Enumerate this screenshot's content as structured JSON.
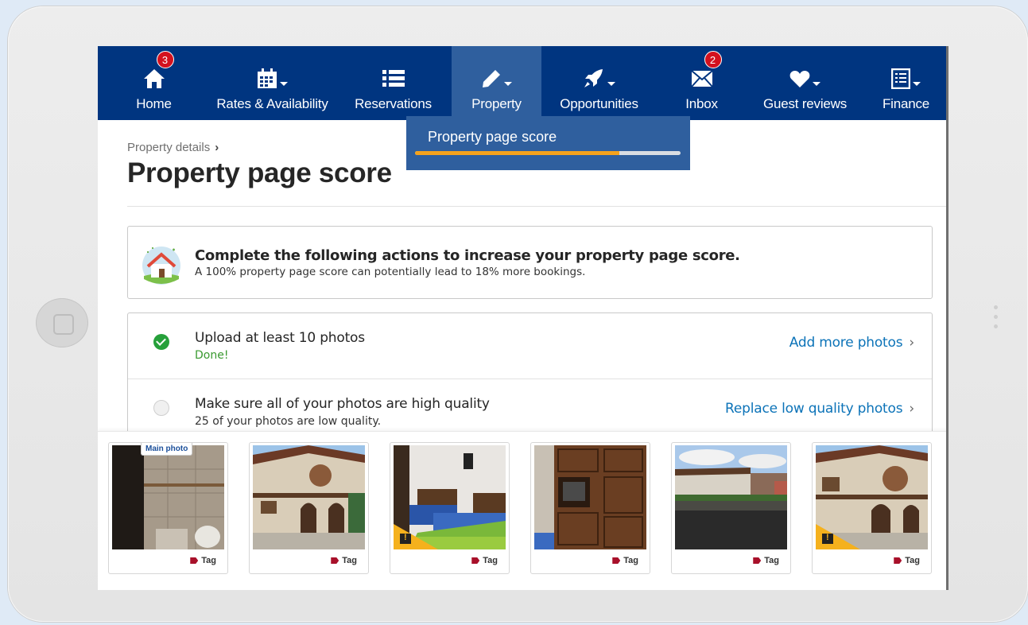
{
  "nav": {
    "items": [
      {
        "label": "Home",
        "icon": "home-icon",
        "badge": "3"
      },
      {
        "label": "Rates & Availability",
        "icon": "calendar-icon"
      },
      {
        "label": "Reservations",
        "icon": "list-icon"
      },
      {
        "label": "Property",
        "icon": "pencil-icon",
        "active": true
      },
      {
        "label": "Opportunities",
        "icon": "rocket-icon"
      },
      {
        "label": "Inbox",
        "icon": "envelope-icon",
        "badge": "2"
      },
      {
        "label": "Guest reviews",
        "icon": "heart-icon"
      },
      {
        "label": "Finance",
        "icon": "document-icon"
      }
    ]
  },
  "dropdown": {
    "label": "Property page score",
    "progress": 0.77
  },
  "page": {
    "breadcrumb": "Property details",
    "title": "Property page score"
  },
  "info": {
    "title": "Complete the following actions to increase your property page score.",
    "subtitle": "A 100% property page score can potentially lead to 18% more bookings."
  },
  "tasks": [
    {
      "title": "Upload at least 10 photos",
      "status": "Done!",
      "link": "Add more photos",
      "done": true
    },
    {
      "title": "Make sure all of your photos are high quality",
      "status": "25 of your photos are low quality.",
      "link": "Replace low quality photos",
      "done": false
    }
  ],
  "photos": {
    "main_badge": "Main photo",
    "tag_label": "Tag",
    "items": [
      {
        "warning": false
      },
      {
        "warning": false
      },
      {
        "warning": true
      },
      {
        "warning": false
      },
      {
        "warning": false
      },
      {
        "warning": true
      }
    ]
  },
  "colors": {
    "nav_bg": "#003580",
    "nav_active": "#2f5f9e",
    "link": "#0c73b8",
    "done": "#26a03a",
    "progress": "#f4a21d",
    "badge": "#d4111e",
    "warning": "#f5b11d"
  }
}
